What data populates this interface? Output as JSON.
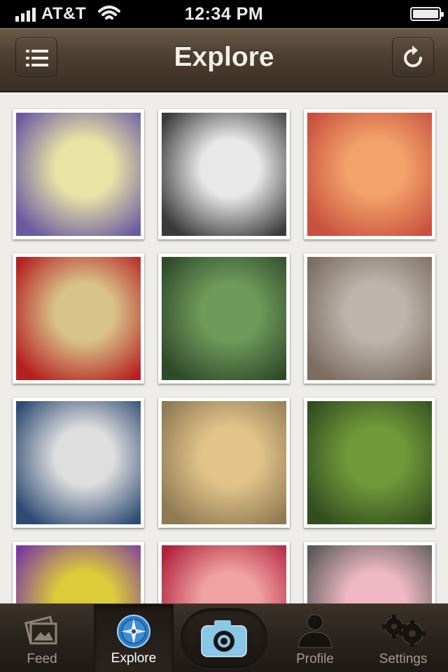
{
  "status_bar": {
    "carrier": "AT&T",
    "time": "12:34 PM",
    "signal_bars": 4,
    "battery_level": 1.0
  },
  "nav": {
    "title": "Explore",
    "left_icon": "list-menu-icon",
    "right_icon": "refresh-icon"
  },
  "photos": [
    {
      "icon": "dog-photo",
      "colors": [
        "#e9e3a6",
        "#6a5aa0"
      ]
    },
    {
      "icon": "portrait-photo",
      "colors": [
        "#e8e8e8",
        "#3a3a3a"
      ]
    },
    {
      "icon": "portrait-photo",
      "colors": [
        "#f3a26a",
        "#c8503e"
      ]
    },
    {
      "icon": "food-photo",
      "colors": [
        "#d8c48a",
        "#b52020"
      ]
    },
    {
      "icon": "group-photo",
      "colors": [
        "#6f9a5a",
        "#2f4a2a"
      ]
    },
    {
      "icon": "outdoor-photo",
      "colors": [
        "#bdb5ac",
        "#7c6d60"
      ]
    },
    {
      "icon": "dog-photo",
      "colors": [
        "#dedede",
        "#2e4b73"
      ]
    },
    {
      "icon": "food-photo",
      "colors": [
        "#e2c48a",
        "#8f7a52"
      ]
    },
    {
      "icon": "plants-photo",
      "colors": [
        "#6f9a3a",
        "#324d1f"
      ]
    },
    {
      "icon": "dog-photo",
      "colors": [
        "#ddcc3a",
        "#7b3aa0"
      ]
    },
    {
      "icon": "smile-photo",
      "colors": [
        "#f0a2a2",
        "#b0203a"
      ]
    },
    {
      "icon": "toy-photo",
      "colors": [
        "#efb8c4",
        "#5a5a5a"
      ]
    }
  ],
  "tabs": [
    {
      "label": "Feed",
      "icon": "photos-stack-icon",
      "active": false
    },
    {
      "label": "Explore",
      "icon": "compass-icon",
      "active": true
    },
    {
      "label": "",
      "icon": "camera-icon",
      "active": false
    },
    {
      "label": "Profile",
      "icon": "person-icon",
      "active": false
    },
    {
      "label": "Settings",
      "icon": "gears-icon",
      "active": false
    }
  ],
  "colors": {
    "nav_background": "#4c3e30",
    "content_background": "#efedea",
    "tab_active_label": "#ffffff",
    "tab_inactive_label": "#a39a8f",
    "compass_blue": "#3a8fd8",
    "camera_blue": "#8ac6e6"
  }
}
